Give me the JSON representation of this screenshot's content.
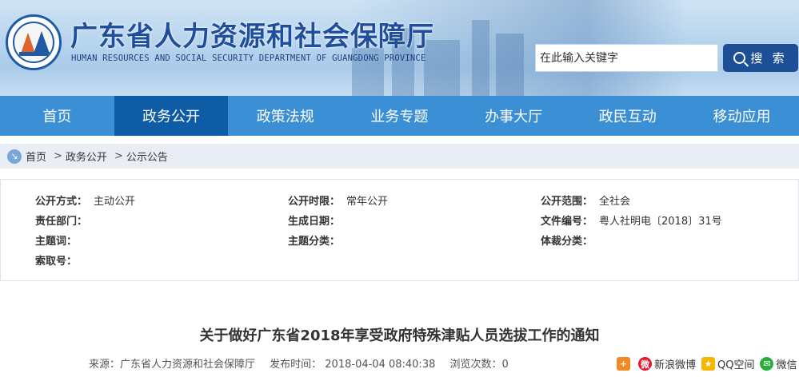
{
  "header": {
    "title": "广东省人力资源和社会保障厅",
    "subtitle": "HUMAN RESOURCES AND SOCIAL SECURITY DEPARTMENT OF GUANGDONG PROVINCE"
  },
  "search": {
    "placeholder": "在此输入关键字",
    "button_label": "搜 索",
    "icon": "search-icon"
  },
  "nav": {
    "items": [
      {
        "label": "首页",
        "active": false
      },
      {
        "label": "政务公开",
        "active": true
      },
      {
        "label": "政策法规",
        "active": false
      },
      {
        "label": "业务专题",
        "active": false
      },
      {
        "label": "办事大厅",
        "active": false
      },
      {
        "label": "政民互动",
        "active": false
      },
      {
        "label": "移动应用",
        "active": false
      }
    ],
    "color": "#3b8fd4",
    "active_color": "#0e5ba6"
  },
  "breadcrumb": {
    "items": [
      "首页",
      "政务公开",
      "公示公告"
    ],
    "separator": ">"
  },
  "info": {
    "rows": [
      [
        {
          "key": "公开方式：",
          "value": "主动公开"
        },
        {
          "key": "公开时限：",
          "value": "常年公开"
        },
        {
          "key": "公开范围：",
          "value": "全社会"
        }
      ],
      [
        {
          "key": "责任部门：",
          "value": ""
        },
        {
          "key": "生成日期：",
          "value": ""
        },
        {
          "key": "文件编号：",
          "value": "粤人社明电〔2018〕31号"
        }
      ],
      [
        {
          "key": "主题词：",
          "value": ""
        },
        {
          "key": "主题分类：",
          "value": ""
        },
        {
          "key": "体裁分类：",
          "value": ""
        }
      ],
      [
        {
          "key": "索取号：",
          "value": ""
        }
      ]
    ]
  },
  "article": {
    "title": "关于做好广东省2018年享受政府特殊津贴人员选拔工作的通知",
    "source": "来源：广东省人力资源和社会保障厅",
    "publish_time": "发布时间： 2018-04-04 08:40:38",
    "views": "浏览次数：0"
  },
  "share": {
    "items": [
      {
        "label": "",
        "icon": "share-plus-icon",
        "color": "#f08a24"
      },
      {
        "label": "新浪微博",
        "icon": "weibo-icon",
        "color": "#e6162d"
      },
      {
        "label": "QQ空间",
        "icon": "qzone-icon",
        "color": "#f5b700"
      },
      {
        "label": "微信",
        "icon": "wechat-icon",
        "color": "#2aae3a"
      }
    ]
  }
}
